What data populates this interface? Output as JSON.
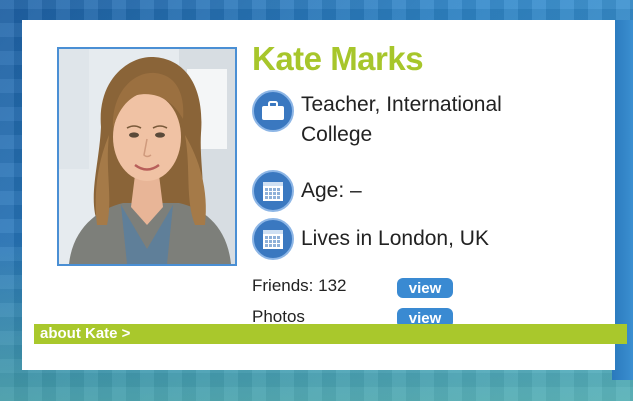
{
  "profile": {
    "name": "Kate Marks",
    "occupation_line1": "Teacher, International",
    "occupation_line2": "College",
    "age": "Age: –",
    "location": "Lives in London, UK",
    "friends_label": "Friends: 132",
    "photos_label": "Photos",
    "view_label": "view",
    "about_link": "about Kate >"
  },
  "icons": {
    "occupation": "briefcase-icon",
    "age": "calendar-icon",
    "location": "calendar-icon"
  },
  "colors": {
    "name_green": "#a7c62b",
    "bar_green": "#a9c82c",
    "button_blue": "#3a8ad2",
    "icon_blue": "#3a78c0"
  }
}
